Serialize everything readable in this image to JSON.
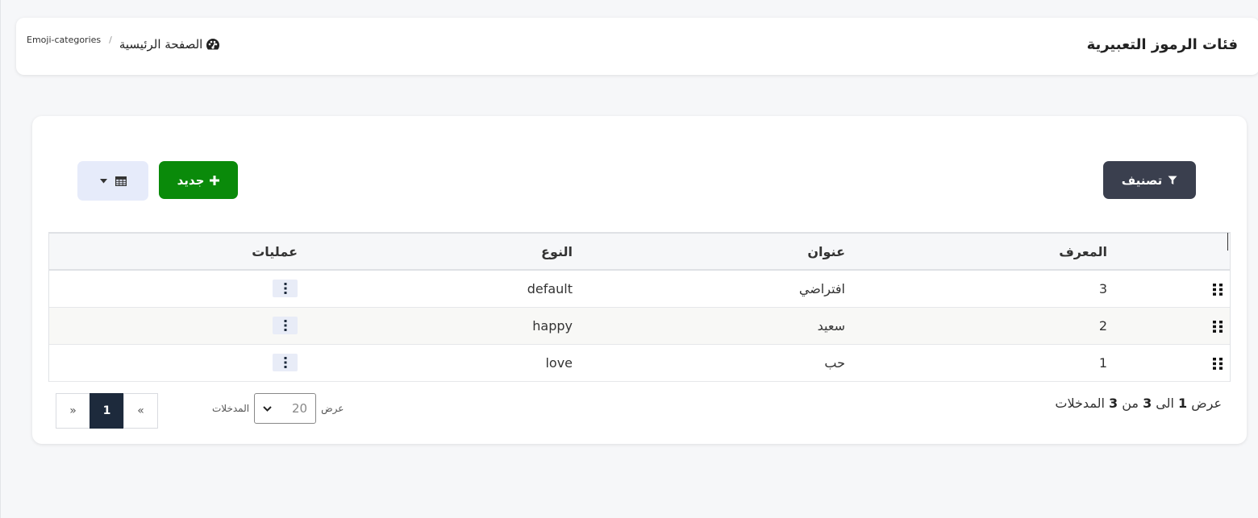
{
  "header": {
    "title": "فئات الرموز التعبيرية",
    "breadcrumb": {
      "home_label": "الصفحة الرئيسية",
      "home_icon": "dashboard-gauge-icon",
      "separator": "/",
      "current": "Emoji-categories"
    }
  },
  "toolbar": {
    "filter_label": "تصنيف",
    "filter_icon": "filter-funnel-icon",
    "new_label": "جديد",
    "new_icon": "plus-icon",
    "columns_icon": "table-grid-icon",
    "columns_caret_icon": "caret-down-icon"
  },
  "table": {
    "headers": {
      "id": "المعرف",
      "title": "عنوان",
      "type": "النوع",
      "operations": "عمليات"
    },
    "rows": [
      {
        "id": "3",
        "title": "افتراضي",
        "type": "default"
      },
      {
        "id": "2",
        "title": "سعيد",
        "type": "happy"
      },
      {
        "id": "1",
        "title": "حب",
        "type": "love"
      }
    ]
  },
  "footer": {
    "summary": {
      "prefix": "عرض",
      "from": "1",
      "to_word": "الى",
      "to": "3",
      "of_word": "من",
      "total": "3",
      "suffix": "المدخلات"
    },
    "per_page": {
      "label_show": "عرض",
      "value": "20",
      "label_entries": "المدخلات"
    },
    "pagination": {
      "prev": "«",
      "current": "1",
      "next": "»"
    }
  },
  "colors": {
    "filter_button": "#3a3f4e",
    "new_button": "#0a8a0a",
    "columns_button": "#e6ebfa",
    "active_page": "#1d2a3c"
  }
}
